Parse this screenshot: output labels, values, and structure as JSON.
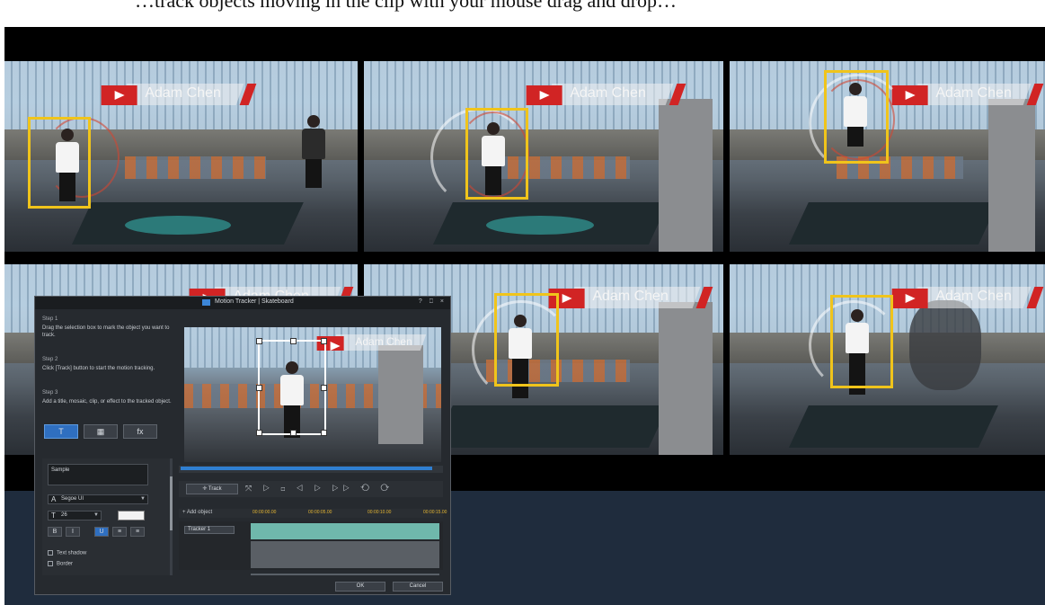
{
  "caption": {
    "text": "…track objects moving in the clip with your mouse drag and drop…"
  },
  "banner_name": "Adam Chen",
  "tiles": [
    {
      "name": "Adam Chen"
    },
    {
      "name": "Adam Chen"
    },
    {
      "name": "Adam Chen"
    },
    {
      "name": "Adam Chen"
    },
    {
      "name": "Adam Chen"
    },
    {
      "name": "Adam Chen"
    }
  ],
  "dialog": {
    "title": "Motion Tracker | Skateboard",
    "controls": "? ⎕ ×",
    "steps": [
      {
        "title": "Step 1",
        "text": "Drag the selection box to mark the object you want to track."
      },
      {
        "title": "Step 2",
        "text": "Click [Track] button to start the motion tracking."
      },
      {
        "title": "Step 3",
        "text": "Add a title, mosaic, clip, or effect to the tracked object."
      }
    ],
    "tools": [
      "T",
      "▦",
      "fx"
    ],
    "text_value": "Sample",
    "font": "Segoe UI",
    "size": "26",
    "format_buttons": [
      "B",
      "I",
      "U",
      "≡",
      "≡"
    ],
    "checkboxes": [
      "Text shadow",
      "Border"
    ],
    "track_button": "Track",
    "playback_icons": "⤧ ▷ ◻ ◁ ▷ ▷▷ ⟲ ⟳",
    "add_object": "+ Add object",
    "ruler_ticks": [
      "00:00:00.00",
      "00:00:05.00",
      "00:00:10.00",
      "00:00:15.00"
    ],
    "track_label": "Tracker 1",
    "ok": "OK",
    "cancel": "Cancel"
  },
  "colors": {
    "track_box": "#f0c41b",
    "brand_red": "#d12424",
    "panel": "#1f2c3d",
    "accent": "#2f6fc0"
  }
}
